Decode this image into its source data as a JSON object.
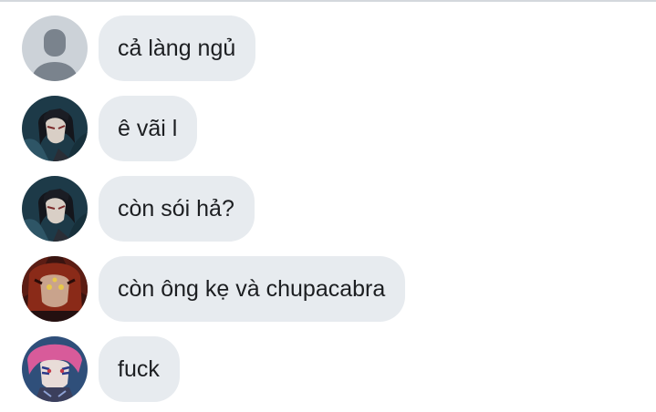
{
  "messages": [
    {
      "avatar": "default-user-avatar",
      "text": "cả làng ngủ"
    },
    {
      "avatar": "anime-dark-haired-character-avatar",
      "text": "ê vãi l"
    },
    {
      "avatar": "anime-dark-haired-character-avatar",
      "text": "còn sói hả?"
    },
    {
      "avatar": "anime-red-demon-character-avatar",
      "text": "còn ông kẹ và chupacabra"
    },
    {
      "avatar": "anime-pink-haired-character-avatar",
      "text": "fuck"
    }
  ],
  "colors": {
    "bubble_bg": "#e7ebef",
    "text": "#1c1e21",
    "default_avatar_bg": "#ccd2d8",
    "default_avatar_fg": "#7a838d"
  }
}
